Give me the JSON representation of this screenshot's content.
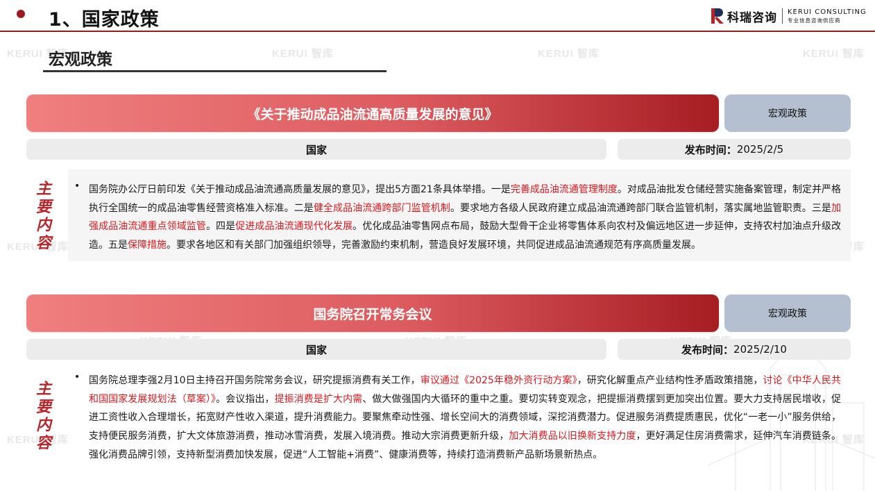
{
  "header": {
    "title": "1、国家政策",
    "logo_cn": "科瑞咨询",
    "logo_en": "KERUI CONSULTING",
    "logo_tagline": "专业信息咨询供应商",
    "accent_color": "#9b1c20"
  },
  "watermark": {
    "text": "KERUI 智库"
  },
  "section": {
    "title": "宏观政策"
  },
  "side_label": [
    "主",
    "要",
    "内",
    "容"
  ],
  "policies": [
    {
      "title": "《关于推动成品油流通高质量发展的意见》",
      "tag": "宏观政策",
      "scope": "国家",
      "date_label": "发布时间：",
      "date": "2025/2/5",
      "segments": [
        {
          "t": "国务院办公厅日前印发《关于推动成品油流通高质量发展的意见》，提出5方面21条具体举措。一是",
          "h": false
        },
        {
          "t": "完善成品油流通管理制度",
          "h": true
        },
        {
          "t": "。对成品油批发仓储经营实施备案管理，制定并严格执行全国统一的成品油零售经营资格准入标准。二是",
          "h": false
        },
        {
          "t": "健全成品油流通跨部门监管机制",
          "h": true
        },
        {
          "t": "。要求地方各级人民政府建立成品油流通跨部门联合监管机制，落实属地监管职责。三是",
          "h": false
        },
        {
          "t": "加强成品油流通重点领域监管",
          "h": true
        },
        {
          "t": "。四是",
          "h": false
        },
        {
          "t": "促进成品油流通现代化发展",
          "h": true
        },
        {
          "t": "。优化成品油零售网点布局，鼓励大型骨干企业将零售体系向农村及偏远地区进一步延伸，支持农村加油点升级改造。五是",
          "h": false
        },
        {
          "t": "保障措施",
          "h": true
        },
        {
          "t": "。要求各地区和有关部门加强组织领导，完善激励约束机制，营造良好发展环境，共同促进成品油流通规范有序高质量发展。",
          "h": false
        }
      ]
    },
    {
      "title": "国务院召开常务会议",
      "tag": "宏观政策",
      "scope": "国家",
      "date_label": "发布时间：",
      "date": "2025/2/10",
      "segments": [
        {
          "t": "国务院总理李强2月10日主持召开国务院常务会议，研究提振消费有关工作，",
          "h": false
        },
        {
          "t": "审议通过《2025年稳外资行动方案》",
          "h": true
        },
        {
          "t": "，研究化解重点产业结构性矛盾政策措施，",
          "h": false
        },
        {
          "t": "讨论《中华人民共和国国家发展规划法（草案）》",
          "h": true
        },
        {
          "t": "。会议指出，",
          "h": false
        },
        {
          "t": "提振消费是扩大内需",
          "h": true
        },
        {
          "t": "、做大做强国内大循环的重中之重。要切实转变观念，把提振消费摆到更加突出位置。要大力支持居民增收，促进工资性收入合理增长，拓宽财产性收入渠道，提升消费能力。要聚焦牵动性强、增长空间大的消费领域，深挖消费潜力。促进服务消费提质惠民，优化“一老一小”服务供给，支持便民服务消费，扩大文体旅游消费，推动冰雪消费，发展入境消费。推动大宗消费更新升级，",
          "h": false
        },
        {
          "t": "加大消费品以旧换新支持力度",
          "h": true
        },
        {
          "t": "，更好满足住房消费需求，延伸汽车消费链条。强化消费品牌引领，支持新型消费加快发展，促进“人工智能+消费”、健康消费等，持续打造消费新产品新场景新热点。",
          "h": false
        }
      ]
    }
  ]
}
